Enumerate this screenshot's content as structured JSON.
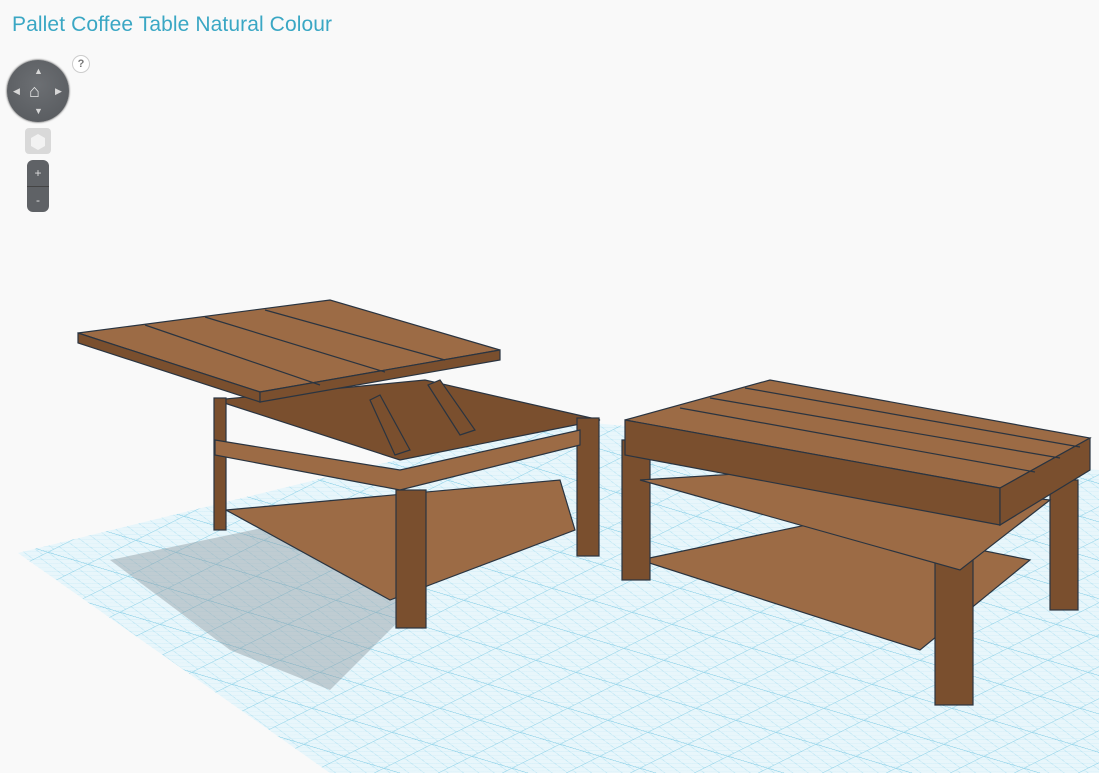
{
  "header": {
    "title": "Pallet Coffee Table Natural Colour"
  },
  "controls": {
    "help_label": "?",
    "nav_up": "▲",
    "nav_down": "▼",
    "nav_left": "◀",
    "nav_right": "▶",
    "nav_home": "⌂",
    "zoom_in": "+",
    "zoom_out": "-"
  },
  "colors": {
    "accent": "#3aa7c4",
    "wood_top": "#9c6b45",
    "wood_side": "#7a4f2e",
    "grid": "#8fd3ea",
    "outline": "#2a3440"
  }
}
